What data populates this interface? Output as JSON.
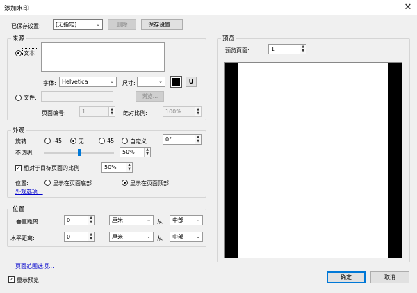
{
  "window": {
    "title": "添加水印",
    "close_glyph": "✕"
  },
  "saved_settings": {
    "label": "已保存设置:",
    "value": "[无指定]",
    "delete_label": "删除",
    "save_label": "保存设置..."
  },
  "source": {
    "group_label": "来源",
    "text_option": "文本",
    "text_value": "",
    "font_label": "字体:",
    "font_value": "Helvetica",
    "size_label": "尺寸:",
    "size_value": "",
    "color": "#000000",
    "underline_label": "U",
    "file_option": "文件:",
    "file_value": "",
    "browse_label": "浏览...",
    "page_num_label": "页面编号:",
    "page_num_value": "1",
    "abs_scale_label": "绝对比例:",
    "abs_scale_value": "100%"
  },
  "appearance": {
    "group_label": "外观",
    "rotation_label": "旋转:",
    "rot_minus45": "-45",
    "rot_none": "无",
    "rot_45": "45",
    "rot_custom": "自定义",
    "rotation_value": "0°",
    "opacity_label": "不透明:",
    "opacity_value": "50%",
    "opacity_fraction": 0.5,
    "relative_scale_label": "相对于目标页面的比例",
    "relative_scale_value": "50%",
    "position_label": "位置:",
    "pos_bottom": "显示在页面底部",
    "pos_top": "显示在页面顶部",
    "options_link": "外观选项..."
  },
  "position": {
    "group_label": "位置",
    "vertical_label": "垂直距离:",
    "vertical_value": "0",
    "vertical_unit": "厘米",
    "vertical_from_label": "从",
    "vertical_anchor": "中部",
    "horizontal_label": "水平距离:",
    "horizontal_value": "0",
    "horizontal_unit": "厘米",
    "horizontal_from_label": "从",
    "horizontal_anchor": "中部"
  },
  "preview": {
    "group_label": "预览",
    "page_label": "预览页面:",
    "page_value": "1"
  },
  "footer": {
    "page_range_link": "页面范围选项...",
    "show_preview_label": "显示预览",
    "ok_label": "确定",
    "cancel_label": "取消"
  }
}
